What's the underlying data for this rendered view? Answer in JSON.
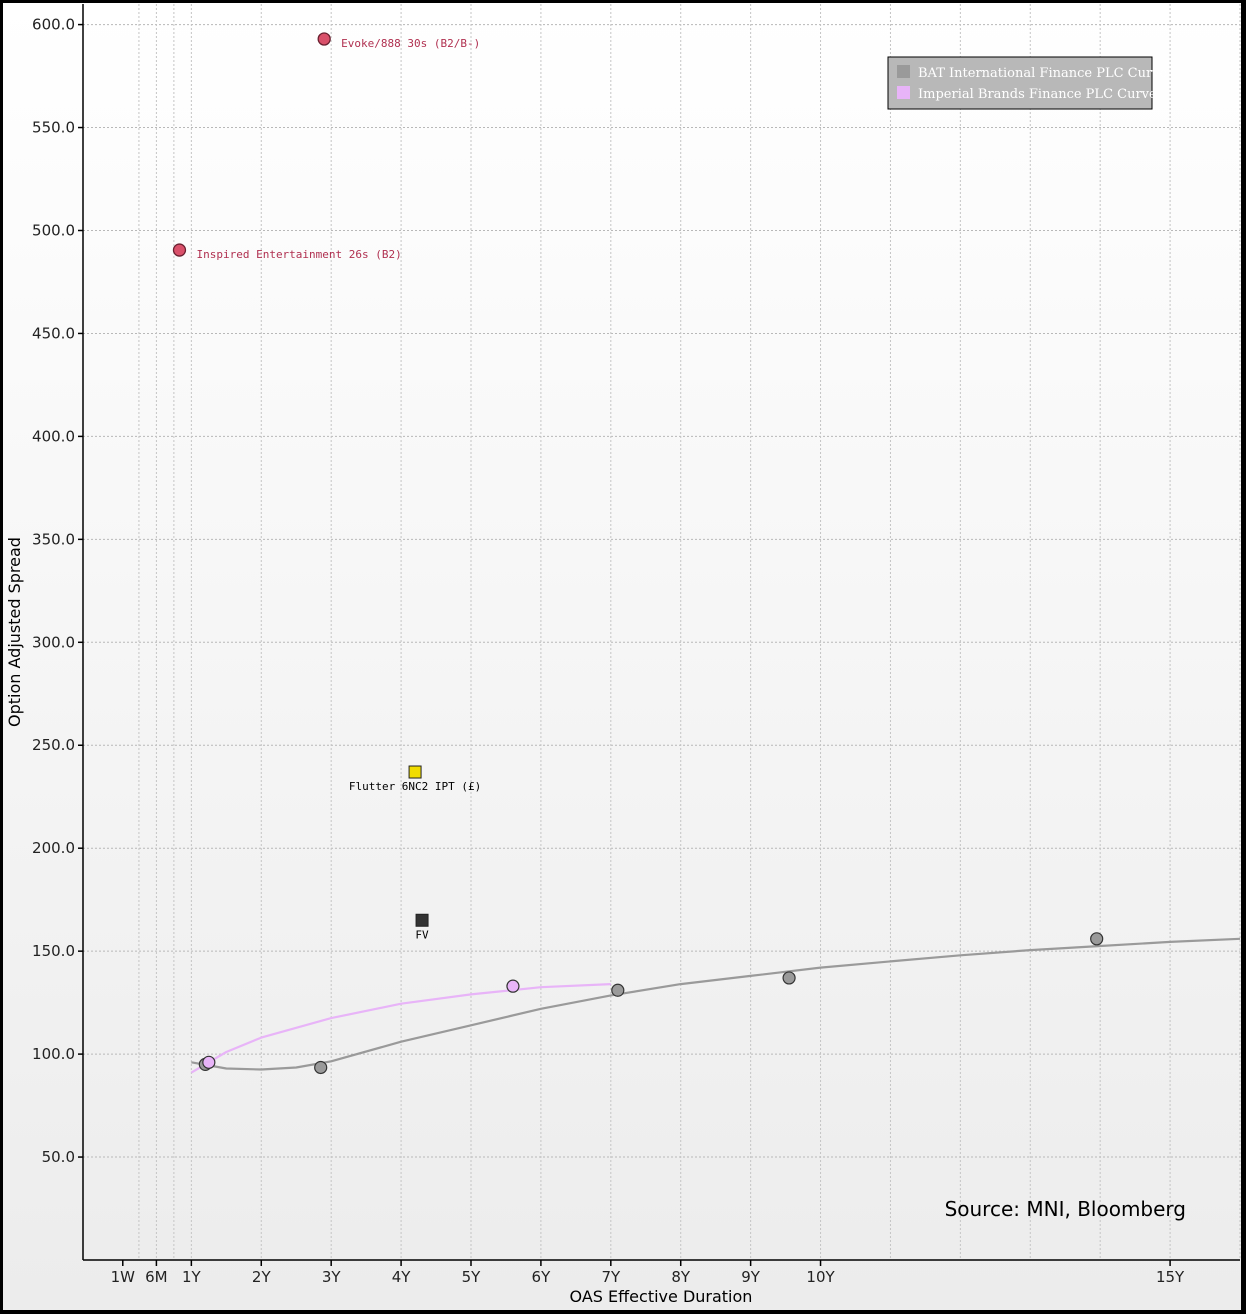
{
  "chart_data": {
    "type": "scatter",
    "title": "",
    "xlabel": "OAS Effective Duration",
    "ylabel": "Option Adjusted Spread",
    "ylim": [
      0,
      610
    ],
    "xlim": [
      -0.55,
      16
    ],
    "grid": true,
    "legend_position": "top-right",
    "y_ticks": [
      50,
      100,
      150,
      200,
      250,
      300,
      350,
      400,
      450,
      500,
      550,
      600
    ],
    "y_tick_labels": [
      "50.0",
      "100.0",
      "150.0",
      "200.0",
      "250.0",
      "300.0",
      "350.0",
      "400.0",
      "450.0",
      "500.0",
      "550.0",
      "600.0"
    ],
    "x_ticks": [
      {
        "value": 0.019,
        "label": "1W"
      },
      {
        "value": 0.5,
        "label": "6M"
      },
      {
        "value": 1,
        "label": "1Y"
      },
      {
        "value": 2,
        "label": "2Y"
      },
      {
        "value": 3,
        "label": "3Y"
      },
      {
        "value": 4,
        "label": "4Y"
      },
      {
        "value": 5,
        "label": "5Y"
      },
      {
        "value": 6,
        "label": "6Y"
      },
      {
        "value": 7,
        "label": "7Y"
      },
      {
        "value": 8,
        "label": "8Y"
      },
      {
        "value": 9,
        "label": "9Y"
      },
      {
        "value": 10,
        "label": "10Y"
      },
      {
        "value": 15,
        "label": "15Y"
      }
    ],
    "series": [
      {
        "name": "BAT International Finance PLC Curve",
        "color": "#9a9a9a",
        "points": [
          [
            1.2,
            95
          ],
          [
            2.85,
            93.5
          ],
          [
            7.1,
            131
          ],
          [
            9.55,
            137
          ],
          [
            13.95,
            156
          ]
        ],
        "curve": [
          [
            1.0,
            96
          ],
          [
            1.5,
            93
          ],
          [
            2.0,
            92.5
          ],
          [
            2.5,
            93.5
          ],
          [
            3.0,
            96.5
          ],
          [
            4.0,
            106
          ],
          [
            5.0,
            114
          ],
          [
            6.0,
            122
          ],
          [
            7.0,
            128.5
          ],
          [
            8.0,
            134
          ],
          [
            9.0,
            138
          ],
          [
            10.0,
            142
          ],
          [
            11.0,
            145
          ],
          [
            12.0,
            148
          ],
          [
            13.0,
            150.5
          ],
          [
            14.0,
            152.5
          ],
          [
            15.0,
            154.5
          ],
          [
            16.0,
            156
          ]
        ]
      },
      {
        "name": "Imperial Brands Finance PLC Curve",
        "color": "#e8b4f8",
        "points": [
          [
            1.25,
            96
          ],
          [
            5.6,
            133
          ]
        ],
        "curve": [
          [
            1.0,
            91
          ],
          [
            1.5,
            101
          ],
          [
            2.0,
            108
          ],
          [
            3.0,
            117.5
          ],
          [
            4.0,
            124.5
          ],
          [
            5.0,
            129
          ],
          [
            6.0,
            132.5
          ],
          [
            7.0,
            134
          ]
        ]
      }
    ],
    "annotations": [
      {
        "label": "Evoke/888 30s (B2/B-)",
        "x": 2.9,
        "y": 593,
        "marker": "circle",
        "color": "#d9506a",
        "text_color": "#b03050"
      },
      {
        "label": "Inspired Entertainment 26s (B2)",
        "x": 0.83,
        "y": 490.5,
        "marker": "circle",
        "color": "#d9506a",
        "text_color": "#b03050"
      },
      {
        "label": "Flutter 6NC2 IPT (£)",
        "x": 4.2,
        "y": 237,
        "marker": "square",
        "color": "#f0dc00",
        "text_color": "#000000"
      },
      {
        "label": "FV",
        "x": 4.3,
        "y": 165,
        "marker": "square",
        "color": "#333333",
        "text_color": "#000000"
      }
    ]
  },
  "source": "Source: MNI, Bloomberg"
}
